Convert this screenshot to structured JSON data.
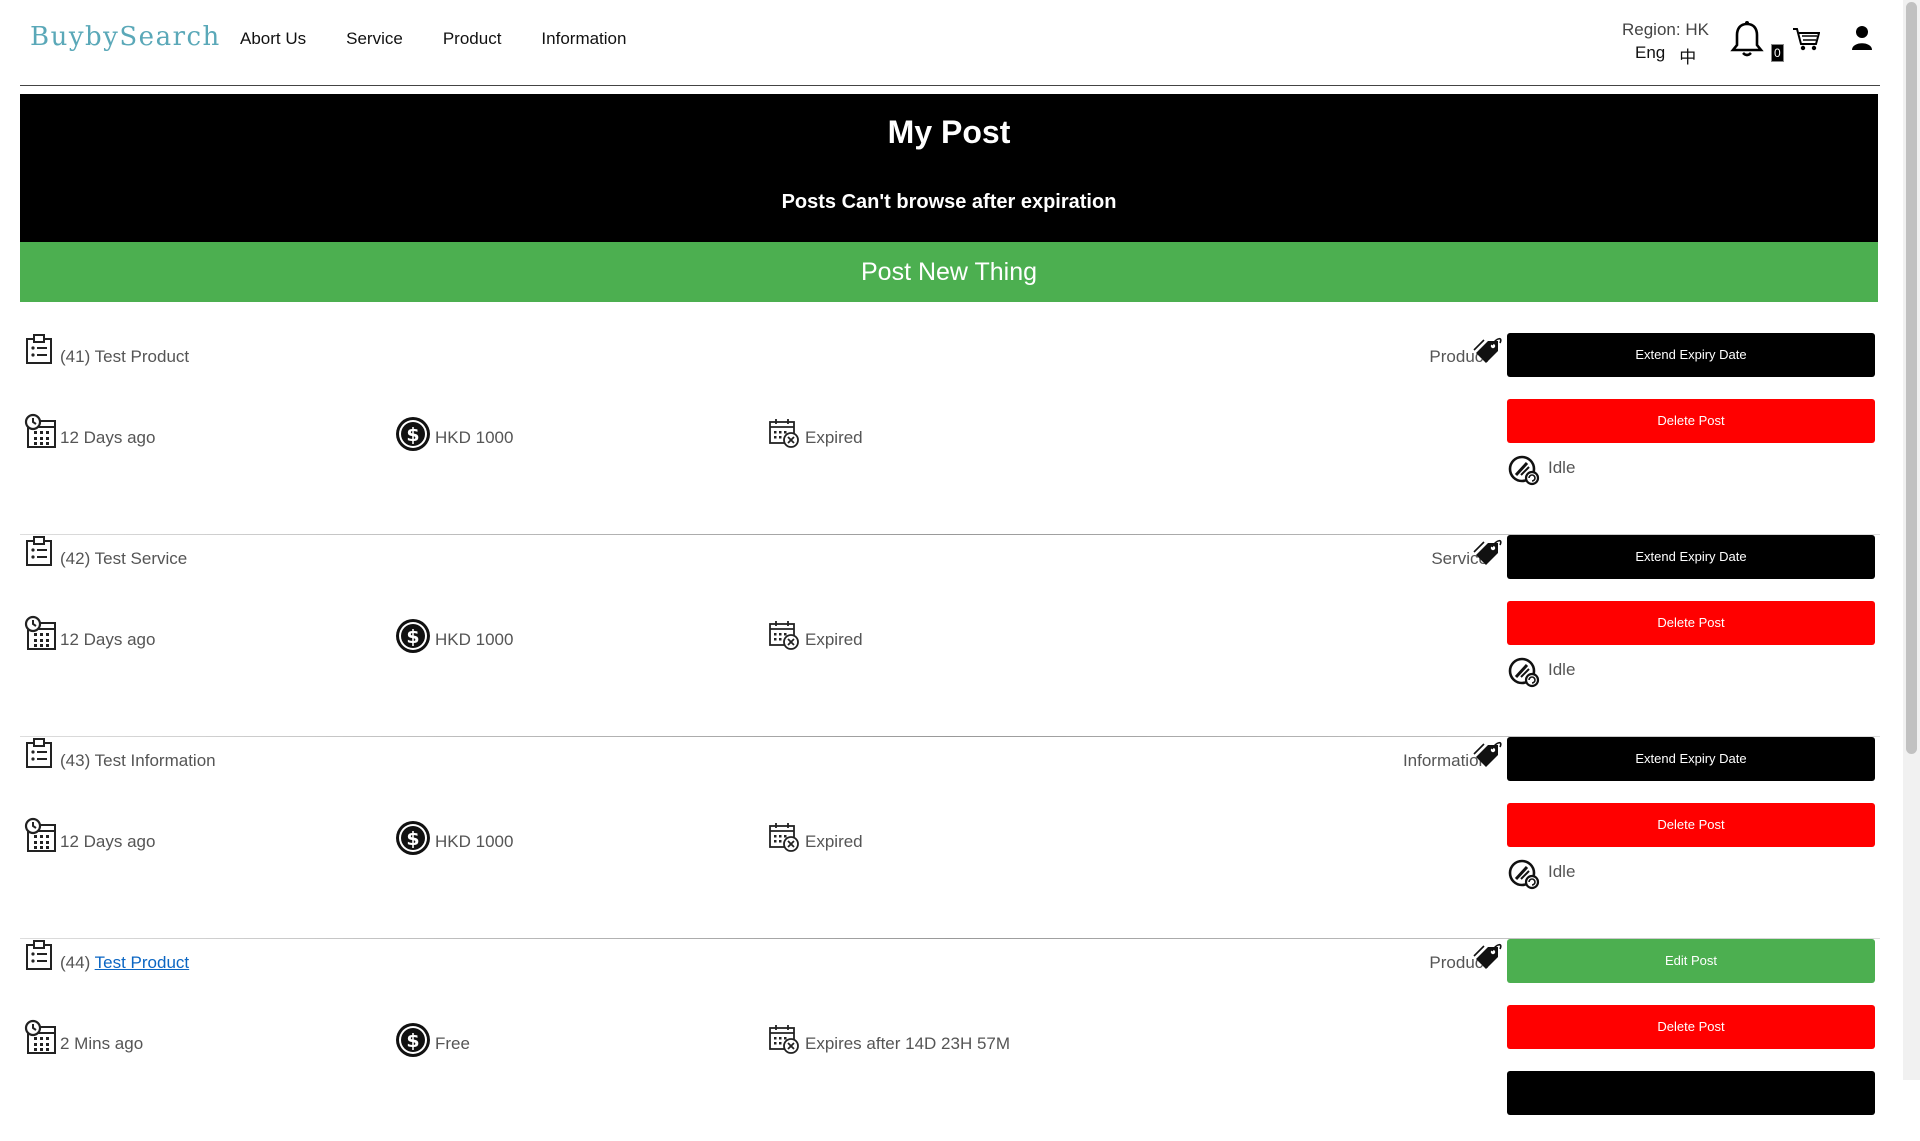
{
  "header": {
    "logo": "BuybySearch",
    "nav": [
      "Abort Us",
      "Service",
      "Product",
      "Information"
    ],
    "region": "Region: HK",
    "lang_en": "Eng",
    "lang_zh": "中",
    "cart_count": "0"
  },
  "banner": {
    "title": "My Post",
    "subtitle": "Posts Can't browse after expiration",
    "post_new": "Post New Thing"
  },
  "posts": [
    {
      "id": "(41)",
      "title": "Test Product",
      "category": "Product",
      "btn1": "Extend Expiry Date",
      "btn2": "Delete Post",
      "date": "12 Days ago",
      "price": "HKD 1000",
      "expiry": "Expired",
      "status": "Idle"
    },
    {
      "id": "(42)",
      "title": "Test Service",
      "category": "Service",
      "btn1": "Extend Expiry Date",
      "btn2": "Delete Post",
      "date": "12 Days ago",
      "price": "HKD 1000",
      "expiry": "Expired",
      "status": "Idle"
    },
    {
      "id": "(43)",
      "title": "Test Information",
      "category": "Information",
      "btn1": "Extend Expiry Date",
      "btn2": "Delete Post",
      "date": "12 Days ago",
      "price": "HKD 1000",
      "expiry": "Expired",
      "status": "Idle"
    },
    {
      "id": "(44)",
      "title": "Test Product",
      "category": "Product",
      "btn1": "Edit Post",
      "btn2": "Delete Post",
      "date": "2 Mins ago",
      "price": "Free",
      "expiry": "Expires after 14D 23H 57M"
    }
  ],
  "colors": {
    "green": "#4caf50",
    "red": "#ff0000",
    "black": "#000000",
    "link": "#0b66c3"
  }
}
